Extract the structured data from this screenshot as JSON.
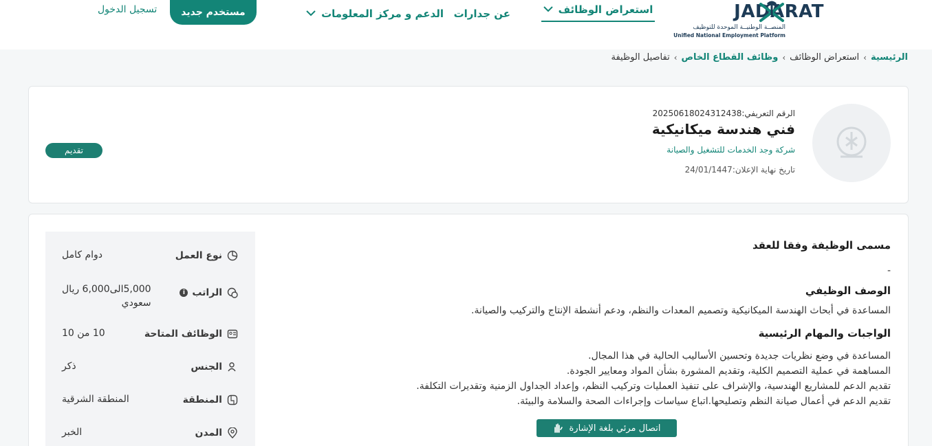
{
  "header": {
    "logo": {
      "wordmark": "JADARAT",
      "arabic_name": "المنصــة الوطنيــة الموحدة للتوظيف",
      "english_name": "Unified National Employment Platform"
    },
    "nav": {
      "browse_jobs": "استعراض الوظائف",
      "about": "عن جدارات",
      "support": "الدعم و مركز المعلومات"
    },
    "new_user_label": "مستخدم جديد",
    "login_label": "تسجيل الدخول"
  },
  "breadcrumb": {
    "home": "الرئيسية",
    "browse": "استعراض الوظائف",
    "private_jobs": "وظائف القطاع الخاص",
    "current": "تفاصيل الوظيفة"
  },
  "job": {
    "id_text": "الرقم التعريفي:20250618024312438",
    "title": "فني هندسة ميكانيكية",
    "company": "شركة وجد الخدمات للتشغيل والصيانة",
    "deadline_text": "تاريخ نهاية الإعلان:24/01/1447",
    "apply_label": "تقديم"
  },
  "details": {
    "contract_title_heading": "مسمى الوظيفة وفقا للعقد",
    "contract_title_value": "-",
    "description_heading": "الوصف الوظيفي",
    "description": "المساعدة في أبحاث الهندسة الميكانيكية وتصميم المعدات والنظم، ودعم أنشطة الإنتاج والتركيب والصيانة.",
    "duties_heading": "الواجبات والمهام الرئيسية",
    "duties": [
      "المساعدة في وضع نظريات جديدة وتحسين الأساليب الحالية في هذا المجال.",
      "المساهمة في عملية التصميم الكلية، وتقديم المشورة بشأن المواد ومعايير الجودة.",
      "تقديم الدعم للمشاريع الهندسية، والإشراف على تنفيذ العمليات وتركيب النظم، وإعداد الجداول الزمنية وتقديرات التكلفة.",
      "تقديم الدعم في أعمال صيانة النظم وتصليحها.اتباع سياسات وإجراءات الصحة والسلامة والبيئة."
    ],
    "sign_language_label": "اتصال مرئي بلغة الإشارة"
  },
  "sidebar": {
    "work_type_label": "نوع العمل",
    "work_type_value": "دوام كامل",
    "salary_label": "الراتب",
    "salary_value_line1": "5,000الى6,000 ريال",
    "salary_value_line2": "سعودي",
    "available_label": "الوظائف المتاحة",
    "available_value": "10 من 10",
    "gender_label": "الجنس",
    "gender_value": "ذكر",
    "region_label": "المنطقة",
    "region_value": "المنطقة الشرقية",
    "city_label": "المدن",
    "city_value": "الخبر"
  },
  "colors": {
    "brand": "#138577",
    "button": "#1d7f72",
    "navy": "#1d3b56"
  }
}
